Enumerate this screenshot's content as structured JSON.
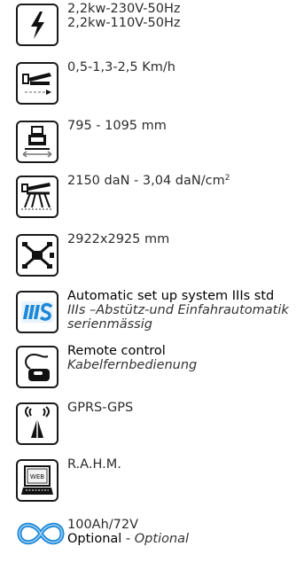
{
  "specs": {
    "power": {
      "icon": "lightning-icon",
      "lines": [
        "2,2kw-230V-50Hz",
        "2,2kw-110V-50Hz"
      ]
    },
    "speed": {
      "icon": "travel-speed-icon",
      "lines": [
        "0,5-1,3-2,5 Km/h"
      ]
    },
    "height": {
      "icon": "track-height-icon",
      "lines": [
        "795 - 1095 mm"
      ]
    },
    "load": {
      "icon": "ground-pressure-icon",
      "line_prefix": "2150 daN - 3,04 daN/cm",
      "superscript": "2"
    },
    "dimensions": {
      "icon": "outrigger-footprint-icon",
      "lines": [
        "2922x2925 mm"
      ]
    },
    "setup": {
      "icon": "iiis-logo-icon",
      "title": "Automatic set up system IIIs std",
      "subtitle_lines": [
        "IIIs –Abstütz-und Einfahrautomatik",
        "serienmässig"
      ]
    },
    "remote": {
      "icon": "remote-control-icon",
      "title": "Remote control",
      "subtitle": "Kabelfernbedienung"
    },
    "gprs": {
      "icon": "antenna-signal-icon",
      "lines": [
        "GPRS-GPS"
      ]
    },
    "rahm": {
      "icon": "web-monitor-icon",
      "lines": [
        "R.A.H.M."
      ]
    },
    "battery": {
      "icon": "battery-infinity-icon",
      "lines": [
        "100Ah/72V"
      ],
      "optional_label": "Optional",
      "optional_separator": " - ",
      "optional_de": "Optional"
    }
  },
  "colors": {
    "icon_border": "#1a1a1a",
    "text": "#2b2b2b",
    "accent_blue": "#1e88d8"
  }
}
